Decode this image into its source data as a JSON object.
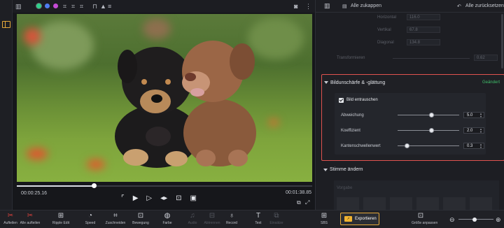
{
  "preview": {
    "current_time": "00:00:25.16",
    "total_time": "00:01:38.85",
    "progress": 0.26,
    "toolbar_icons": [
      "green-circle",
      "blue-circle",
      "purple-circle",
      "crop-icon",
      "crop-icon",
      "crop-icon",
      "lock-icon",
      "mask-icon",
      "layers-icon"
    ],
    "colors": {
      "green": "#2fd08b",
      "blue": "#4f7cf0",
      "purple": "#c54bd6"
    }
  },
  "panel": {
    "undo_label": "Alle zukappen",
    "reset_label": "Alle zurücksetzen",
    "faded_rows": [
      {
        "label": "Horizontal",
        "value": "116.0"
      },
      {
        "label": "Vertikal",
        "value": "67.8"
      },
      {
        "label": "Diagonal",
        "value": "134.8"
      }
    ],
    "transform_label": "Transformieren",
    "transform_value": "0.62",
    "blur_section": {
      "title": "Bildunschärfe & -glättung",
      "status": "Geändert",
      "checkbox_label": "Bild entrauschen",
      "params": [
        {
          "label": "Abweichung",
          "value": "5.0",
          "level": 0.55
        },
        {
          "label": "Koeffizient",
          "value": "2.0",
          "level": 0.55
        },
        {
          "label": "Kantenschwellenwert",
          "value": "0.3",
          "level": 0.15
        }
      ]
    },
    "voice_section": {
      "title": "Stimme ändern",
      "sub_label": "Vorgabe"
    }
  },
  "bottom_toolbar": {
    "tools": [
      {
        "label": "Aufteilen",
        "icon": "scissors-icon"
      },
      {
        "label": "Alle aufteilen",
        "icon": "scissors-all-icon"
      },
      {
        "label": "Ripple Edit",
        "icon": "ripple-icon"
      },
      {
        "label": "Speed",
        "icon": "speed-icon"
      },
      {
        "label": "Zuschneiden",
        "icon": "crop-icon"
      },
      {
        "label": "Bewegung",
        "icon": "motion-icon"
      },
      {
        "label": "Farbe",
        "icon": "palette-icon"
      },
      {
        "label": "Audio",
        "icon": "audio-icon"
      },
      {
        "label": "Abtrennen",
        "icon": "detach-icon"
      },
      {
        "label": "Record",
        "icon": "mic-icon"
      },
      {
        "label": "Text",
        "icon": "text-icon"
      },
      {
        "label": "Einsätze",
        "icon": "insert-icon"
      }
    ],
    "sbs_label": "SBS",
    "export_label": "Exportieren",
    "fit_label": "Größe anpassen",
    "zoom_level": 0.45
  }
}
